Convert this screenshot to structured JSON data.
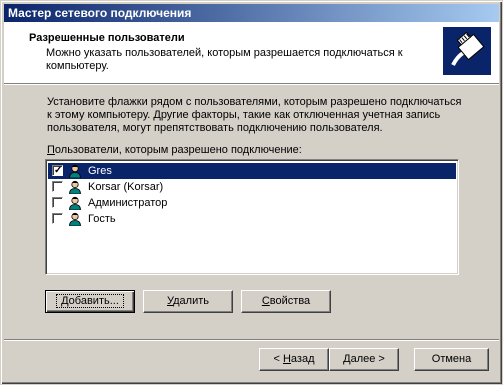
{
  "window": {
    "title": "Мастер сетевого подключения"
  },
  "header": {
    "title": "Разрешенные пользователи",
    "description": "Можно указать пользователей, которым разрешается подключаться к компьютеру.",
    "icon": "network-cable-icon"
  },
  "intro_text": "Установите флажки рядом с пользователями, которым разрешено подключаться к этому компьютеру. Другие факторы, такие как отключенная учетная запись пользователя, могут препятствовать подключению пользователя.",
  "list": {
    "label_prefix": "П",
    "label_rest": "ользователи, которым разрешено подключение:",
    "items": [
      {
        "name": "Gres",
        "checked": true,
        "selected": true
      },
      {
        "name": "Korsar (Korsar)",
        "checked": false,
        "selected": false
      },
      {
        "name": "Администратор",
        "checked": false,
        "selected": false
      },
      {
        "name": "Гость",
        "checked": false,
        "selected": false
      }
    ]
  },
  "buttons": {
    "add": {
      "mn": "Д",
      "rest": "обавить..."
    },
    "remove": {
      "mn": "У",
      "rest": "далить"
    },
    "properties": {
      "mn": "С",
      "rest": "войства"
    },
    "back": {
      "pre": "< ",
      "mn": "Н",
      "rest": "азад"
    },
    "next": {
      "pre": "",
      "mn": "Д",
      "rest": "алее >"
    },
    "cancel": {
      "label": "Отмена"
    }
  }
}
